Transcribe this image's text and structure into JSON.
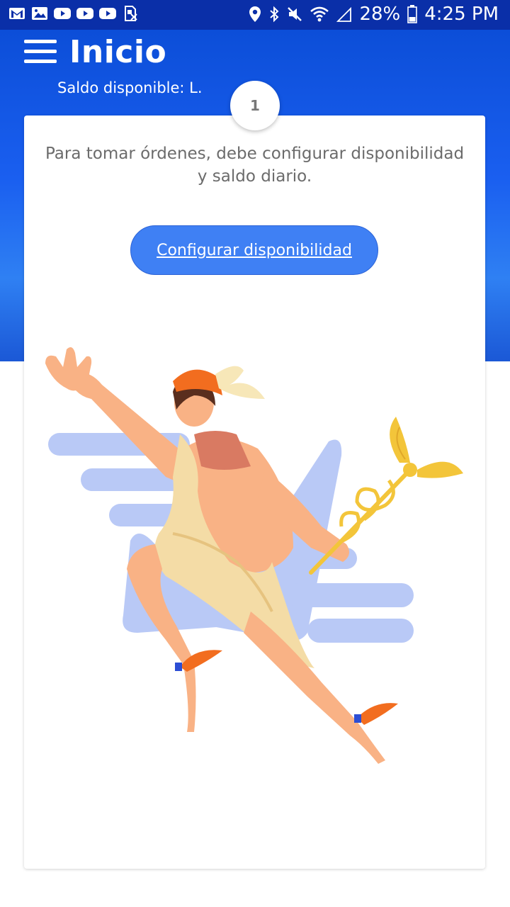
{
  "status_bar": {
    "battery": "28%",
    "time": "4:25 PM",
    "left_icons": [
      "gmail-icon",
      "gallery-icon",
      "youtube-icon",
      "youtube-icon",
      "youtube-icon",
      "sim-icon"
    ],
    "right_icons": [
      "location-icon",
      "bluetooth-icon",
      "mute-icon",
      "wifi-icon",
      "signal-icon",
      "battery-icon"
    ]
  },
  "header": {
    "title": "Inicio",
    "balance_label": "Saldo disponible: L.",
    "menu_icon": "hamburger-icon"
  },
  "badge": {
    "value": "1"
  },
  "card": {
    "instructions": "Para tomar órdenes, debe configurar disponibilidad y saldo diario.",
    "button_label": "Configurar disponibilidad",
    "illustration": "hermes-messenger-illustration"
  },
  "colors": {
    "status_bar": "#0a2fa8",
    "header_top": "#0c4ed8",
    "button": "#3f80f4",
    "text_muted": "#6b6b6b"
  }
}
